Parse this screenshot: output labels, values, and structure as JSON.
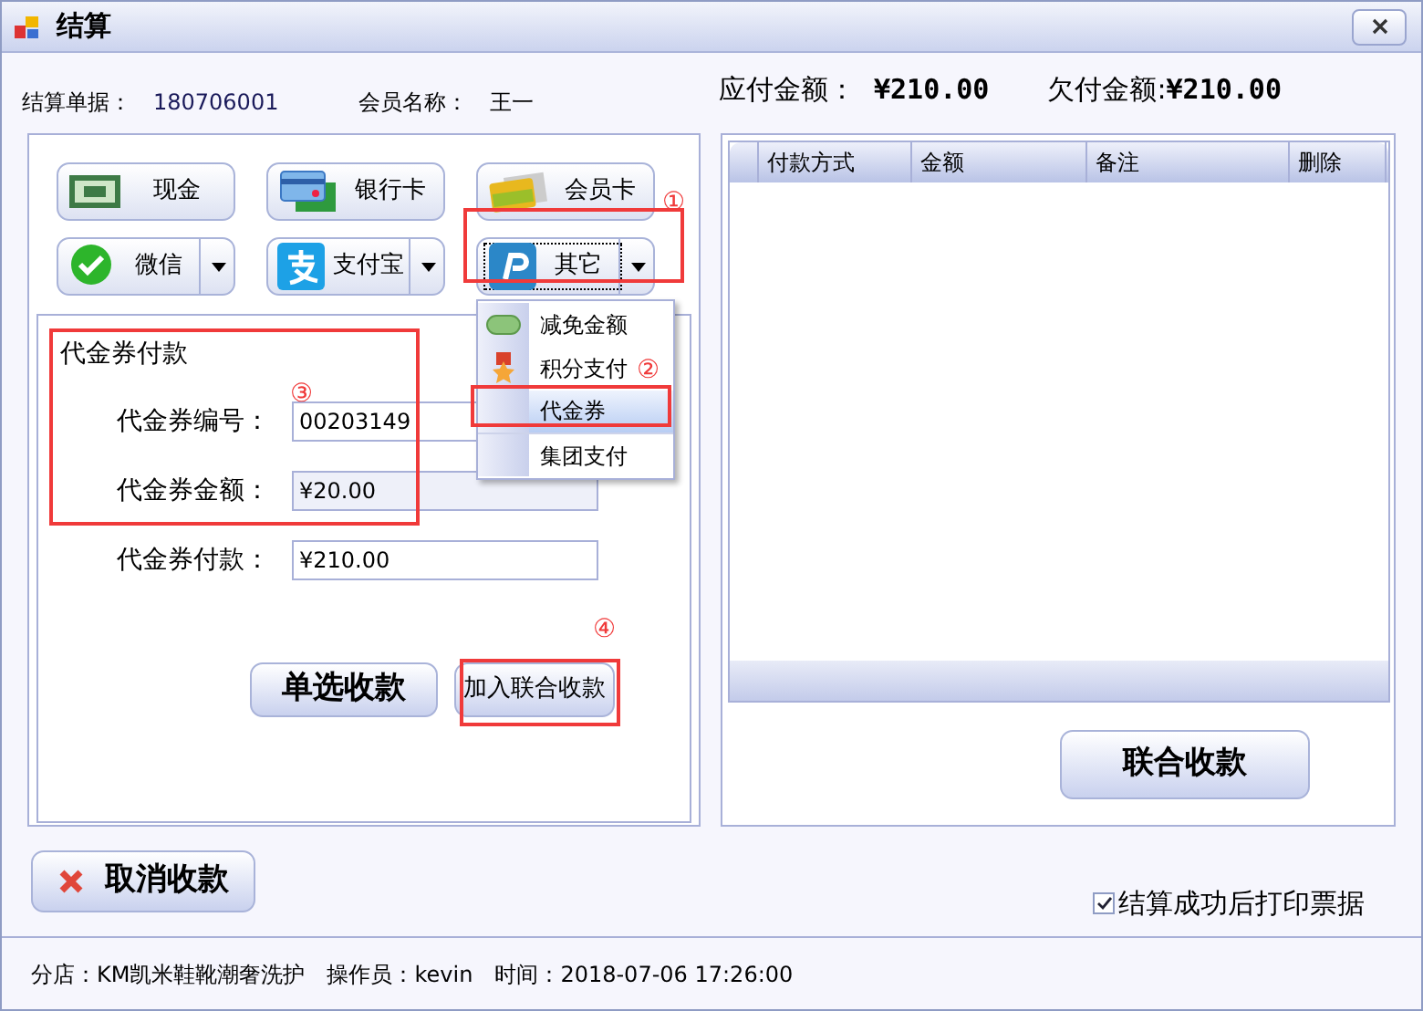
{
  "window": {
    "title": "结算"
  },
  "header": {
    "bill_label": "结算单据：",
    "bill_no": "180706001",
    "member_label": "会员名称：",
    "member": "王一"
  },
  "totals": {
    "payable_label": "应付金额：",
    "payable": "¥210.00",
    "owed_label": "欠付金额:",
    "owed": "¥210.00"
  },
  "payment_buttons": [
    {
      "label": "现金",
      "kind": "cash",
      "dropdown": false,
      "selected": false
    },
    {
      "label": "银行卡",
      "kind": "bank",
      "dropdown": false,
      "selected": false
    },
    {
      "label": "会员卡",
      "kind": "member",
      "dropdown": false,
      "selected": false
    },
    {
      "label": "微信",
      "kind": "wechat",
      "dropdown": true,
      "selected": false
    },
    {
      "label": "支付宝",
      "kind": "alipay",
      "dropdown": true,
      "selected": false
    },
    {
      "label": "其它",
      "kind": "other",
      "dropdown": true,
      "selected": true
    }
  ],
  "menu": [
    {
      "label": "减免金额",
      "kind": "discount",
      "selected": false
    },
    {
      "label": "积分支付",
      "kind": "points",
      "selected": false
    },
    {
      "label": "代金券",
      "kind": "none",
      "selected": true
    },
    {
      "label": "集团支付",
      "kind": "none",
      "selected": false
    }
  ],
  "voucher": {
    "title": "代金券付款",
    "fields": [
      {
        "label": "代金券编号：",
        "value": "00203149",
        "disabled": false
      },
      {
        "label": "代金券金额：",
        "value": "¥20.00",
        "disabled": true
      },
      {
        "label": "代金券付款：",
        "value": "¥210.00",
        "disabled": false
      }
    ],
    "buttons": [
      {
        "label": "单选收款",
        "bold": true
      },
      {
        "label": "加入联合收款",
        "bold": false
      }
    ]
  },
  "table": {
    "columns": [
      "付款方式",
      "金额",
      "备注",
      "删除"
    ]
  },
  "combined_button": "联合收款",
  "cancel_button": "取消收款",
  "print_checkbox": {
    "label": "结算成功后打印票据",
    "checked": true
  },
  "status_bar": {
    "branch": "分店：KM凯米鞋靴潮奢洗护",
    "operator": "操作员：kevin",
    "time": "时间：2018-07-06 17:26:00"
  },
  "annotations": [
    {
      "label": "①"
    },
    {
      "label": "②"
    },
    {
      "label": "③"
    },
    {
      "label": "④"
    }
  ]
}
